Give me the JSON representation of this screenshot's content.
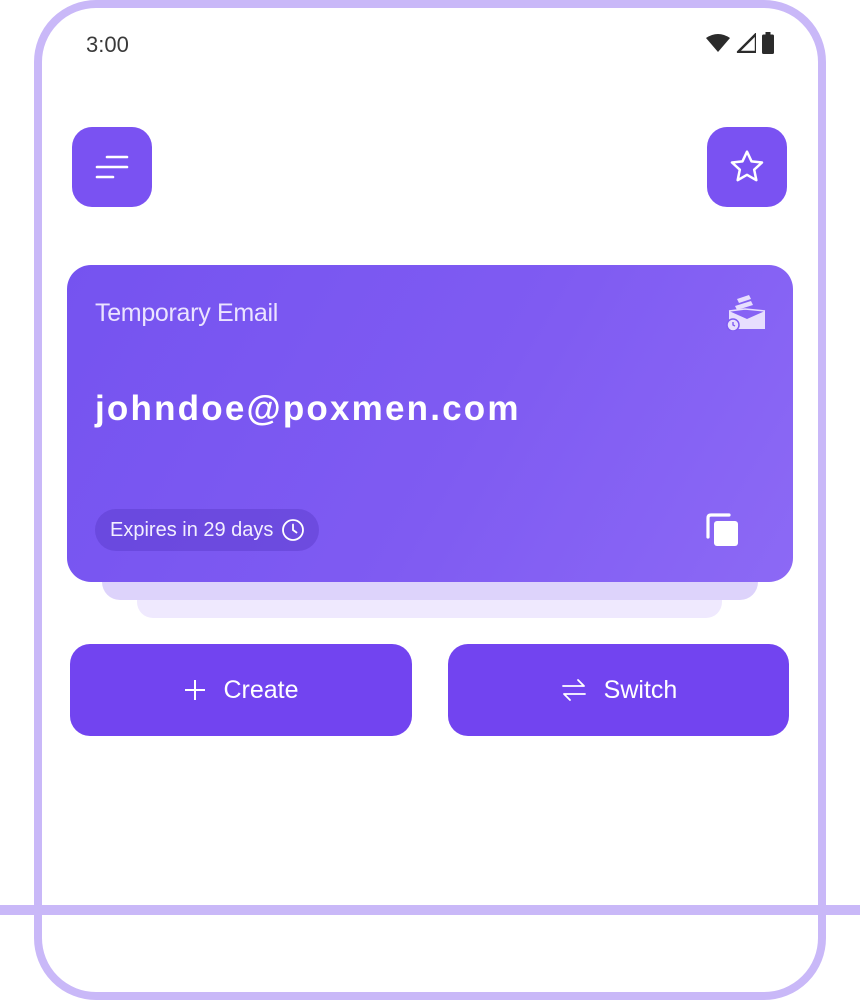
{
  "status_bar": {
    "time": "3:00",
    "icons": [
      "wifi-icon",
      "cell-signal-icon",
      "battery-icon"
    ]
  },
  "header": {
    "menu_icon": "menu-icon",
    "favorite_icon": "star-icon"
  },
  "email_card": {
    "title": "Temporary Email",
    "email": "johndoe@poxmen.com",
    "expiry": "Expires in 29 days",
    "icons": [
      "mail-clock-icon",
      "clock-icon",
      "copy-icon"
    ]
  },
  "actions": {
    "create_label": "Create",
    "switch_label": "Switch",
    "icons": [
      "plus-icon",
      "swap-arrows-icon"
    ]
  },
  "colors": {
    "accent": "#7244f0",
    "card_gradient_start": "#7553f0",
    "card_gradient_end": "#8c69f5",
    "frame": "#c9b8f8"
  }
}
